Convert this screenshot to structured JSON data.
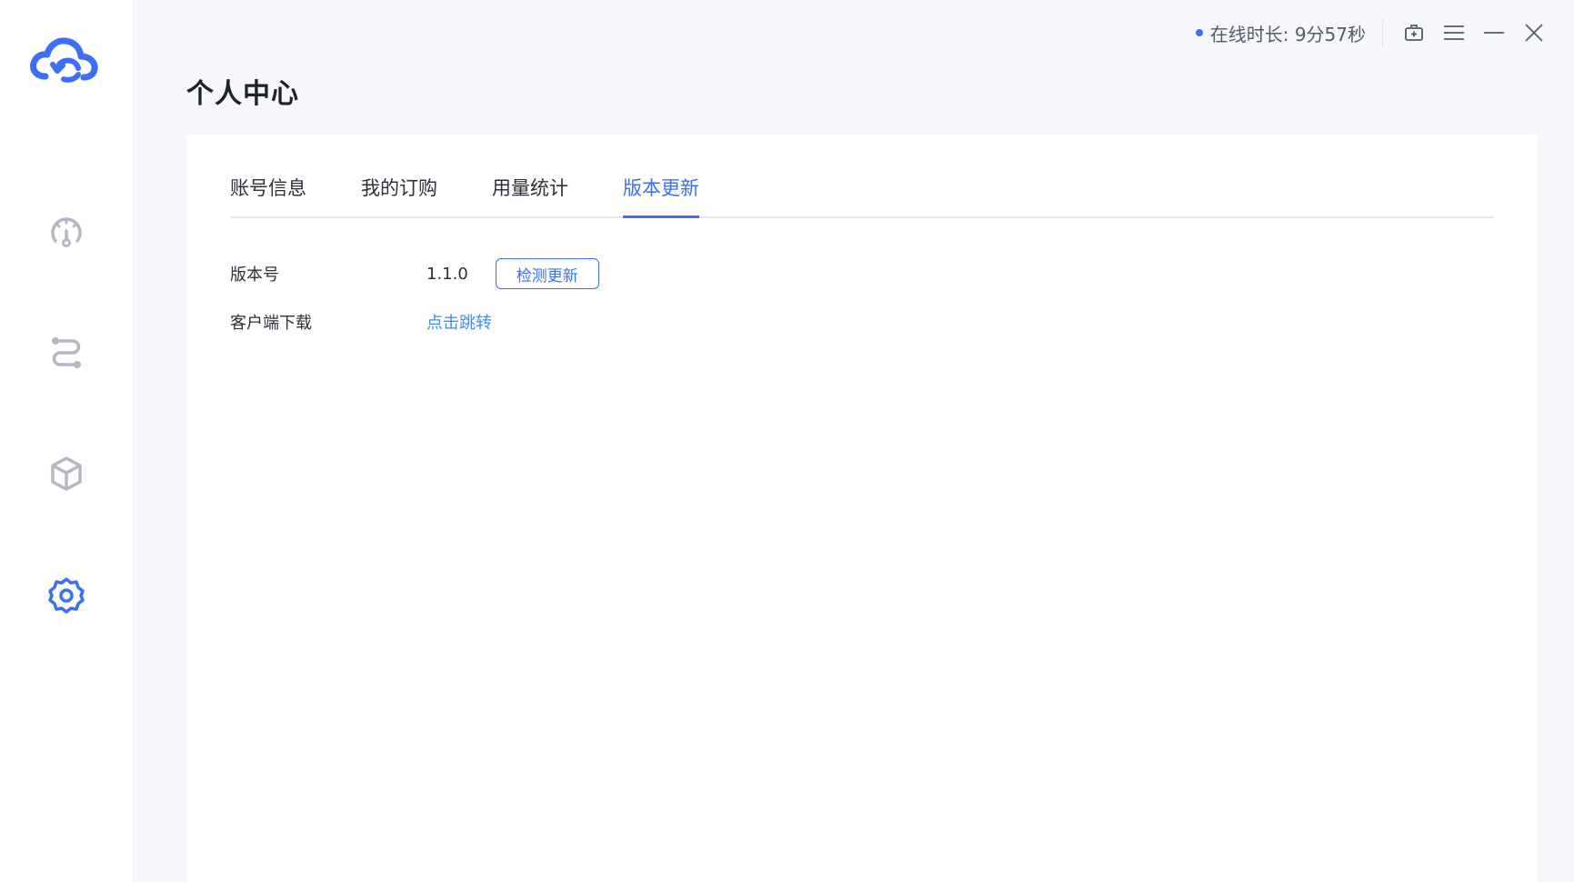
{
  "titlebar": {
    "online_text": "在线时长: 9分57秒",
    "icons": [
      "toolbox-icon",
      "menu-icon",
      "minimize-icon",
      "close-icon"
    ]
  },
  "sidebar": {
    "logo": "cloud-sync-logo",
    "items": [
      {
        "icon": "dashboard-gauge-icon",
        "active": false
      },
      {
        "icon": "route-icon",
        "active": false
      },
      {
        "icon": "cube-icon",
        "active": false
      },
      {
        "icon": "gear-icon",
        "active": true
      }
    ]
  },
  "page": {
    "title": "个人中心"
  },
  "tabs": [
    {
      "label": "账号信息",
      "active": false
    },
    {
      "label": "我的订购",
      "active": false
    },
    {
      "label": "用量统计",
      "active": false
    },
    {
      "label": "版本更新",
      "active": true
    }
  ],
  "version_section": {
    "version_label": "版本号",
    "version_value": "1.1.0",
    "check_update_button": "检测更新",
    "client_download_label": "客户端下载",
    "client_download_link": "点击跳转"
  },
  "colors": {
    "accent": "#3b6ff5",
    "icon_inactive": "#b4b8c2",
    "background": "#f6f7fb"
  }
}
